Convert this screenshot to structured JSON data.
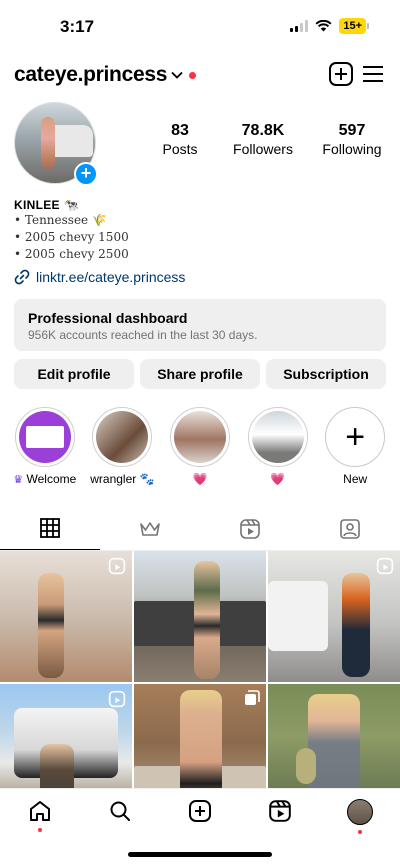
{
  "status_bar": {
    "time": "3:17",
    "battery": "15+"
  },
  "header": {
    "username": "cateye.princess"
  },
  "profile": {
    "stats": [
      {
        "number": "83",
        "label": "Posts"
      },
      {
        "number": "78.8K",
        "label": "Followers"
      },
      {
        "number": "597",
        "label": "Following"
      }
    ],
    "bio": {
      "name": "KINLEE 🐄",
      "lines": [
        "• Tennessee 🌾",
        "• 2005 chevy 1500",
        "• 2005 chevy 2500"
      ],
      "link": "linktr.ee/cateye.princess"
    }
  },
  "dashboard": {
    "title": "Professional dashboard",
    "subtitle": "956K accounts reached in the last 30 days."
  },
  "buttons": {
    "edit": "Edit profile",
    "share": "Share profile",
    "subscription": "Subscription"
  },
  "highlights": [
    {
      "label": "Welcome",
      "prefix": "♛"
    },
    {
      "label": "wrangler 🐾",
      "prefix": ""
    },
    {
      "label": "💗",
      "prefix": ""
    },
    {
      "label": "💗",
      "prefix": ""
    },
    {
      "label": "New",
      "prefix": ""
    }
  ],
  "tabs": [
    "grid-icon",
    "crown-icon",
    "reels-icon",
    "tagged-icon"
  ],
  "posts": [
    {
      "type": "reel"
    },
    {
      "type": "photo"
    },
    {
      "type": "reel"
    },
    {
      "type": "reel"
    },
    {
      "type": "carousel"
    },
    {
      "type": "photo"
    }
  ],
  "bottom_nav": [
    "home-icon",
    "search-icon",
    "create-icon",
    "reels-icon",
    "profile-avatar"
  ]
}
